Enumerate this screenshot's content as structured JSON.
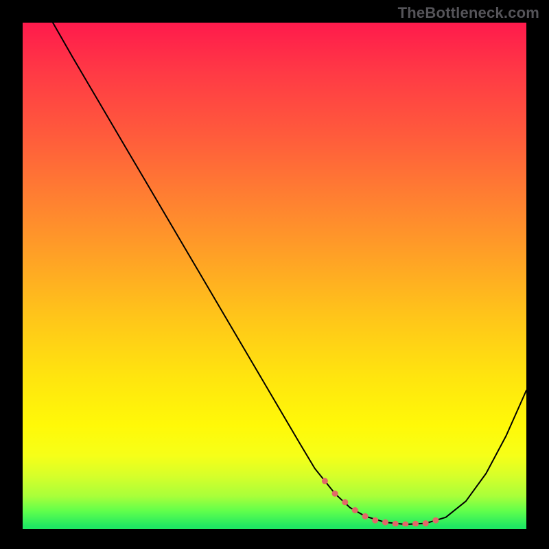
{
  "watermark": "TheBottleneck.com",
  "colors": {
    "background": "#000000",
    "curve_stroke": "#000000",
    "dot_fill": "#e16868",
    "gradient_top": "#ff1a4c",
    "gradient_bottom": "#20e862"
  },
  "chart_data": {
    "type": "line",
    "title": "",
    "xlabel": "",
    "ylabel": "",
    "xlim": [
      0,
      100
    ],
    "ylim": [
      0,
      100
    ],
    "x": [
      6,
      10,
      15,
      20,
      25,
      30,
      35,
      40,
      45,
      50,
      55,
      58,
      62,
      65,
      68,
      72,
      76,
      80,
      84,
      88,
      92,
      96,
      100
    ],
    "values": [
      100,
      93,
      84.5,
      76,
      67.5,
      59,
      50.5,
      42,
      33.5,
      25,
      16.5,
      11.5,
      6.5,
      3.7,
      2.0,
      0.8,
      0.4,
      0.6,
      1.8,
      5.0,
      10.5,
      18.0,
      27.0
    ],
    "marked_region_x": [
      60,
      82
    ],
    "marked_points_x": [
      60,
      62,
      64,
      66,
      68,
      70,
      72,
      74,
      76,
      78,
      80,
      82
    ],
    "marked_points_y": [
      9.0,
      6.5,
      4.8,
      3.2,
      2.0,
      1.2,
      0.8,
      0.5,
      0.4,
      0.5,
      0.6,
      1.2
    ]
  }
}
